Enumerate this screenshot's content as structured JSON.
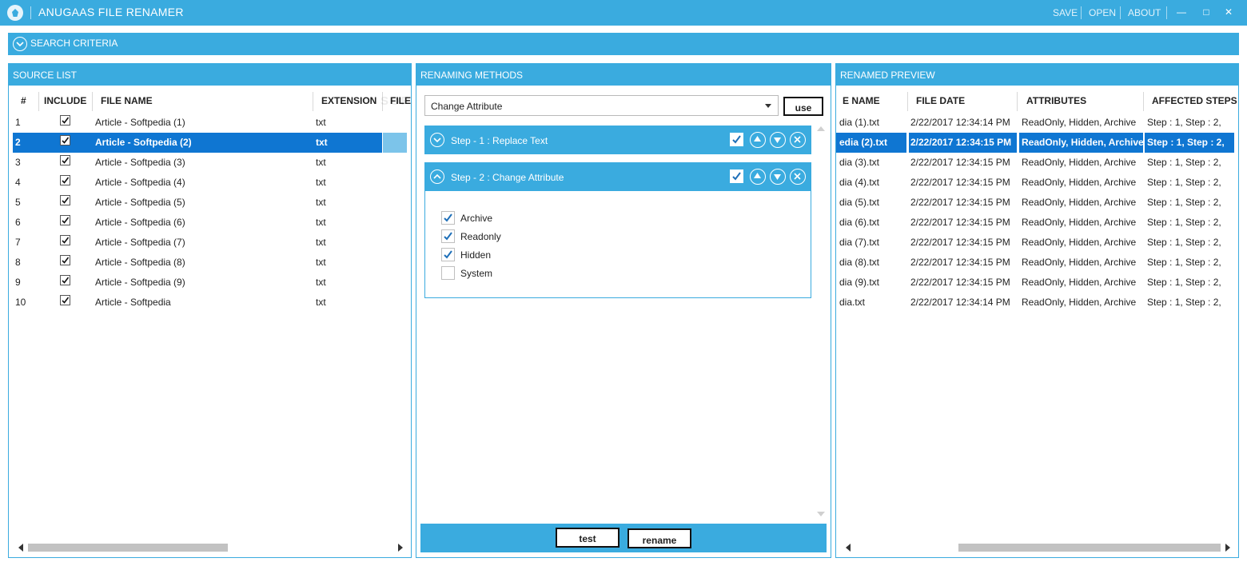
{
  "titlebar": {
    "title": "ANUGAAS FILE RENAMER",
    "menu": [
      "SAVE",
      "OPEN",
      "ABOUT"
    ],
    "controls": {
      "minimize": "—",
      "maximize": "□",
      "close": "✕"
    }
  },
  "search": {
    "label": "SEARCH CRITERIA"
  },
  "source": {
    "title": "SOURCE LIST",
    "columns": [
      "#",
      "INCLUDE",
      "FILE NAME",
      "EXTENSION",
      "FILE"
    ],
    "rows": [
      {
        "num": "1",
        "include": true,
        "name": "Article - Softpedia (1)",
        "ext": "txt"
      },
      {
        "num": "2",
        "include": true,
        "name": "Article - Softpedia (2)",
        "ext": "txt"
      },
      {
        "num": "3",
        "include": true,
        "name": "Article - Softpedia (3)",
        "ext": "txt"
      },
      {
        "num": "4",
        "include": true,
        "name": "Article - Softpedia (4)",
        "ext": "txt"
      },
      {
        "num": "5",
        "include": true,
        "name": "Article - Softpedia (5)",
        "ext": "txt"
      },
      {
        "num": "6",
        "include": true,
        "name": "Article - Softpedia (6)",
        "ext": "txt"
      },
      {
        "num": "7",
        "include": true,
        "name": "Article - Softpedia (7)",
        "ext": "txt"
      },
      {
        "num": "8",
        "include": true,
        "name": "Article - Softpedia (8)",
        "ext": "txt"
      },
      {
        "num": "9",
        "include": true,
        "name": "Article - Softpedia (9)",
        "ext": "txt"
      },
      {
        "num": "10",
        "include": true,
        "name": "Article - Softpedia",
        "ext": "txt"
      }
    ],
    "selected_row": 1
  },
  "methods": {
    "title": "RENAMING METHODS",
    "selected_method": "Change Attribute",
    "use_label": "use",
    "steps": [
      {
        "title": "Step - 1 : Replace Text",
        "enabled": true,
        "expanded": false
      },
      {
        "title": "Step - 2 : Change Attribute",
        "enabled": true,
        "expanded": true
      }
    ],
    "attributes": [
      {
        "label": "Archive",
        "checked": true
      },
      {
        "label": "Readonly",
        "checked": true
      },
      {
        "label": "Hidden",
        "checked": true
      },
      {
        "label": "System",
        "checked": false
      }
    ],
    "test_label": "test",
    "rename_label": "rename"
  },
  "preview": {
    "title": "RENAMED PREVIEW",
    "columns": [
      "E NAME",
      "FILE DATE",
      "ATTRIBUTES",
      "AFFECTED STEPS"
    ],
    "rows": [
      {
        "name": "dia (1).txt",
        "date": "2/22/2017 12:34:14 PM",
        "attrs": "ReadOnly, Hidden, Archive",
        "steps": "Step : 1, Step : 2,"
      },
      {
        "name": "edia (2).txt",
        "date": "2/22/2017 12:34:15 PM",
        "attrs": "ReadOnly, Hidden, Archive",
        "steps": "Step : 1, Step : 2,"
      },
      {
        "name": "dia (3).txt",
        "date": "2/22/2017 12:34:15 PM",
        "attrs": "ReadOnly, Hidden, Archive",
        "steps": "Step : 1, Step : 2,"
      },
      {
        "name": "dia (4).txt",
        "date": "2/22/2017 12:34:15 PM",
        "attrs": "ReadOnly, Hidden, Archive",
        "steps": "Step : 1, Step : 2,"
      },
      {
        "name": "dia (5).txt",
        "date": "2/22/2017 12:34:15 PM",
        "attrs": "ReadOnly, Hidden, Archive",
        "steps": "Step : 1, Step : 2,"
      },
      {
        "name": "dia (6).txt",
        "date": "2/22/2017 12:34:15 PM",
        "attrs": "ReadOnly, Hidden, Archive",
        "steps": "Step : 1, Step : 2,"
      },
      {
        "name": "dia (7).txt",
        "date": "2/22/2017 12:34:15 PM",
        "attrs": "ReadOnly, Hidden, Archive",
        "steps": "Step : 1, Step : 2,"
      },
      {
        "name": "dia (8).txt",
        "date": "2/22/2017 12:34:15 PM",
        "attrs": "ReadOnly, Hidden, Archive",
        "steps": "Step : 1, Step : 2,"
      },
      {
        "name": "dia (9).txt",
        "date": "2/22/2017 12:34:15 PM",
        "attrs": "ReadOnly, Hidden, Archive",
        "steps": "Step : 1, Step : 2,"
      },
      {
        "name": "dia.txt",
        "date": "2/22/2017 12:34:14 PM",
        "attrs": "ReadOnly, Hidden, Archive",
        "steps": "Step : 1, Step : 2,"
      }
    ],
    "selected_row": 1
  },
  "watermark": "SOFTPEDIA",
  "colors": {
    "accent": "#3aabdf",
    "selection": "#0f76d2",
    "selection_cell": "#7cc4ea"
  },
  "icons": [
    "app-logo-icon",
    "chevron-down-circle-icon",
    "chevron-up-circle-icon",
    "checkbox-icon",
    "arrow-up-circle-icon",
    "arrow-down-circle-icon",
    "close-circle-icon",
    "dropdown-caret-icon",
    "scroll-left-icon",
    "scroll-right-icon"
  ]
}
